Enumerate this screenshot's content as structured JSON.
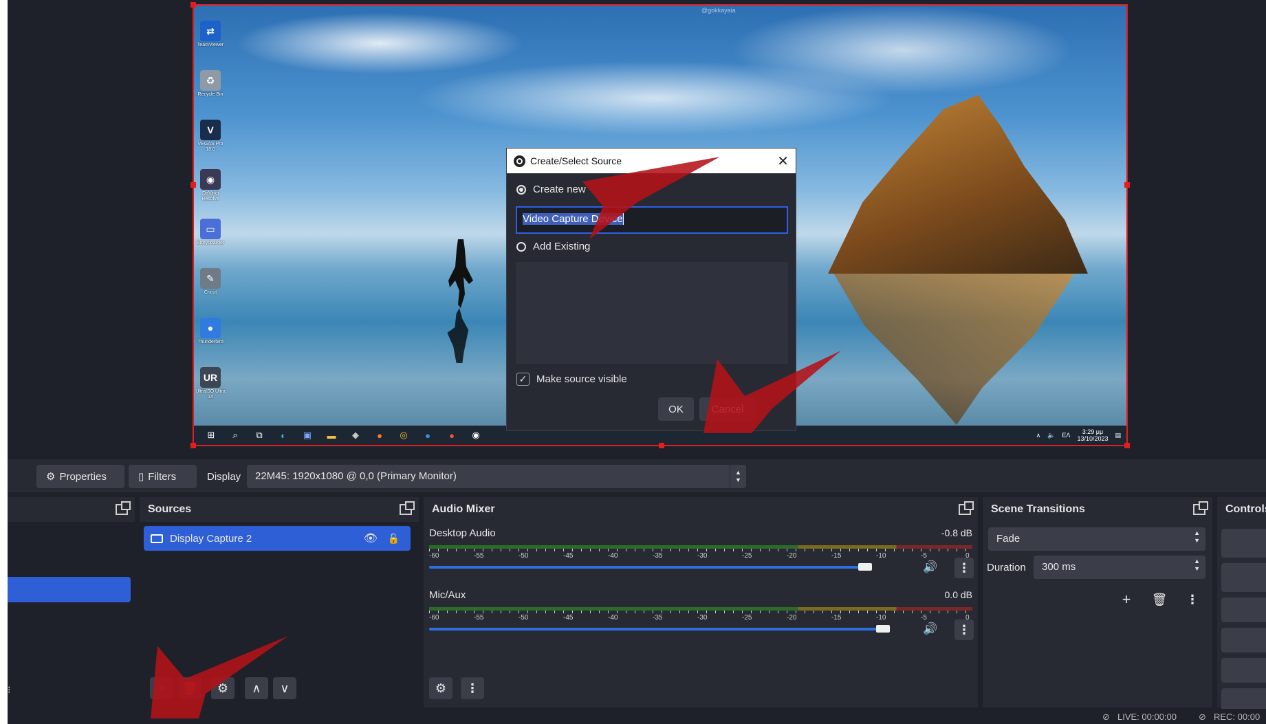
{
  "preview": {
    "watermark": "@gokkayaia",
    "desktop_icons": [
      {
        "label": "TeamViewer",
        "glyph": "⇄",
        "color": "#1c62c9"
      },
      {
        "label": "Recycle Bin",
        "glyph": "♻",
        "color": "#8e9aa6"
      },
      {
        "label": "VEGAS Pro 18.0",
        "glyph": "V",
        "color": "#1a2d4a"
      },
      {
        "label": "DaVinci Resolve",
        "glyph": "◉",
        "color": "#3a3a55"
      },
      {
        "label": "Storyboarder",
        "glyph": "▭",
        "color": "#4a6fd6"
      },
      {
        "label": "Cricut",
        "glyph": "✎",
        "color": "#6f7b86"
      },
      {
        "label": "Thunderbird",
        "glyph": "●",
        "color": "#2f7be0"
      },
      {
        "label": "UltraISO Ultra 14",
        "glyph": "UR",
        "color": "#3d4654"
      }
    ],
    "tray": {
      "lang": "ΕΛ",
      "time": "3:29 μμ",
      "date": "13/10/2023"
    }
  },
  "dialog": {
    "title": "Create/Select Source",
    "create_new_label": "Create new",
    "name_value_selected": "Video Capture Device",
    "add_existing_label": "Add Existing",
    "make_visible_label": "Make source visible",
    "make_visible_checked": true,
    "ok_label": "OK",
    "cancel_label": "Cancel"
  },
  "propbar": {
    "properties_label": "Properties",
    "filters_label": "Filters",
    "display_label": "Display",
    "display_value": "22M45: 1920x1080 @ 0,0 (Primary Monitor)"
  },
  "sources": {
    "title": "Sources",
    "items": [
      {
        "name": "Display Capture 2"
      }
    ]
  },
  "mixer": {
    "title": "Audio Mixer",
    "scale": [
      "-60",
      "-55",
      "-50",
      "-45",
      "-40",
      "-35",
      "-30",
      "-25",
      "-20",
      "-15",
      "-10",
      "-5",
      "0"
    ],
    "channels": [
      {
        "name": "Desktop Audio",
        "db": "-0.8 dB",
        "level": 0.96
      },
      {
        "name": "Mic/Aux",
        "db": "0.0 dB",
        "level": 1.0
      }
    ]
  },
  "transitions": {
    "title": "Scene Transitions",
    "selected": "Fade",
    "duration_label": "Duration",
    "duration_value": "300 ms"
  },
  "controls": {
    "title": "Controls"
  },
  "status": {
    "live": "LIVE: 00:00:00",
    "rec": "REC: 00:00"
  }
}
